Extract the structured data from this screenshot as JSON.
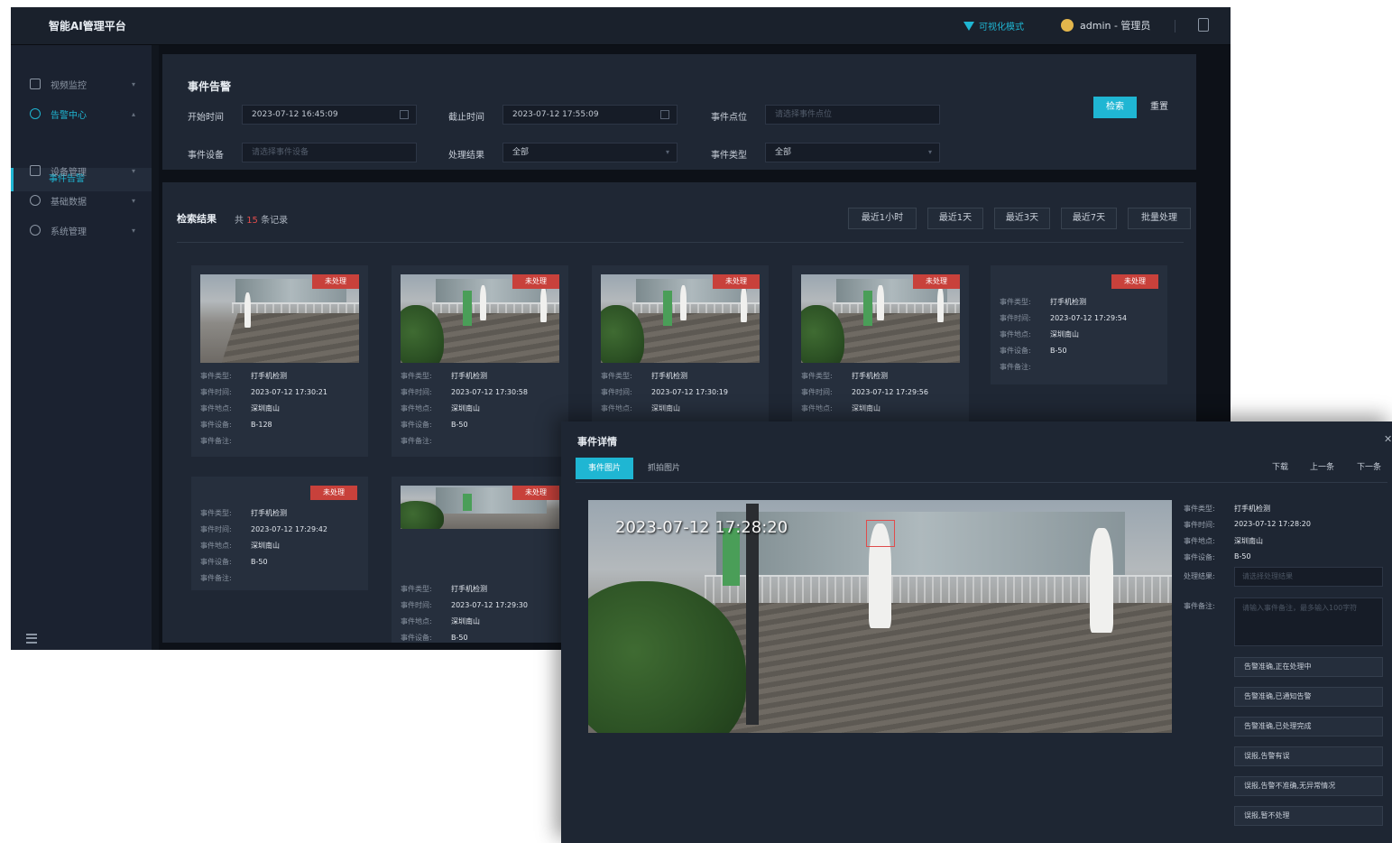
{
  "app": {
    "title": "智能AI管理平台",
    "view_mode": "可视化模式",
    "user": "admin - 管理员"
  },
  "sidebar": {
    "items": [
      {
        "label": "视频监控",
        "icon": "monitor-icon"
      },
      {
        "label": "告警中心",
        "icon": "bell-icon"
      },
      {
        "label": "设备管理",
        "icon": "camera-icon"
      },
      {
        "label": "基础数据",
        "icon": "database-icon"
      },
      {
        "label": "系统管理",
        "icon": "gear-icon"
      }
    ],
    "active_sub": "事件告警"
  },
  "filters": {
    "title": "事件告警",
    "start_label": "开始时间",
    "start_value": "2023-07-12 16:45:09",
    "end_label": "截止时间",
    "end_value": "2023-07-12 17:55:09",
    "point_label": "事件点位",
    "point_placeholder": "请选择事件点位",
    "device_label": "事件设备",
    "device_placeholder": "请选择事件设备",
    "result_label": "处理结果",
    "result_value": "全部",
    "type_label": "事件类型",
    "type_value": "全部",
    "search": "检索",
    "reset": "重置"
  },
  "results": {
    "title": "检索结果",
    "count_prefix": "共",
    "count": "15",
    "count_suffix": "条记录",
    "quick": [
      "最近1小时",
      "最近1天",
      "最近3天",
      "最近7天",
      "批量处理"
    ]
  },
  "card_keys": {
    "type": "事件类型:",
    "time": "事件时间:",
    "place": "事件地点:",
    "device": "事件设备:",
    "note": "事件备注:"
  },
  "cards": [
    {
      "badge": "未处理",
      "type": "打手机检测",
      "time": "2023-07-12 17:30:21",
      "place": "深圳南山",
      "device": "B-128"
    },
    {
      "badge": "未处理",
      "type": "打手机检测",
      "time": "2023-07-12 17:30:58",
      "place": "深圳南山",
      "device": "B-50"
    },
    {
      "badge": "未处理",
      "type": "打手机检测",
      "time": "2023-07-12 17:30:19",
      "place": "深圳南山"
    },
    {
      "badge": "未处理",
      "type": "打手机检测",
      "time": "2023-07-12 17:29:56",
      "place": "深圳南山"
    },
    {
      "badge": "未处理",
      "type": "打手机检测",
      "time": "2023-07-12 17:29:54",
      "place": "深圳南山",
      "device": "B-50"
    },
    {
      "badge": "未处理",
      "type": "打手机检测",
      "time": "2023-07-12 17:29:42",
      "place": "深圳南山",
      "device": "B-50"
    },
    {
      "badge": "未处理",
      "type": "打手机检测",
      "time": "2023-07-12 17:29:30",
      "place": "深圳南山",
      "device": "B-50"
    }
  ],
  "modal": {
    "title": "事件详情",
    "tab_event": "事件图片",
    "tab_record": "抓拍图片",
    "download": "下载",
    "prev": "上一条",
    "next": "下一条",
    "timestamp": "2023-07-12 17:28:20",
    "type_key": "事件类型:",
    "type_val": "打手机检测",
    "time_key": "事件时间:",
    "time_val": "2023-07-12 17:28:20",
    "place_key": "事件地点:",
    "place_val": "深圳南山",
    "device_key": "事件设备:",
    "device_val": "B-50",
    "result_key": "处理结果:",
    "result_placeholder": "请选择处理结果",
    "note_key": "事件备注:",
    "note_placeholder": "请输入事件备注，最多输入100字符",
    "actions": [
      "告警准确,正在处理中",
      "告警准确,已通知告警",
      "告警准确,已处理完成",
      "误报,告警有误",
      "误报,告警不准确,无异常情况",
      "误报,暂不处理"
    ]
  },
  "colors": {
    "accent": "#1fb6d3",
    "danger": "#c8413b",
    "panel": "#1f2734"
  }
}
